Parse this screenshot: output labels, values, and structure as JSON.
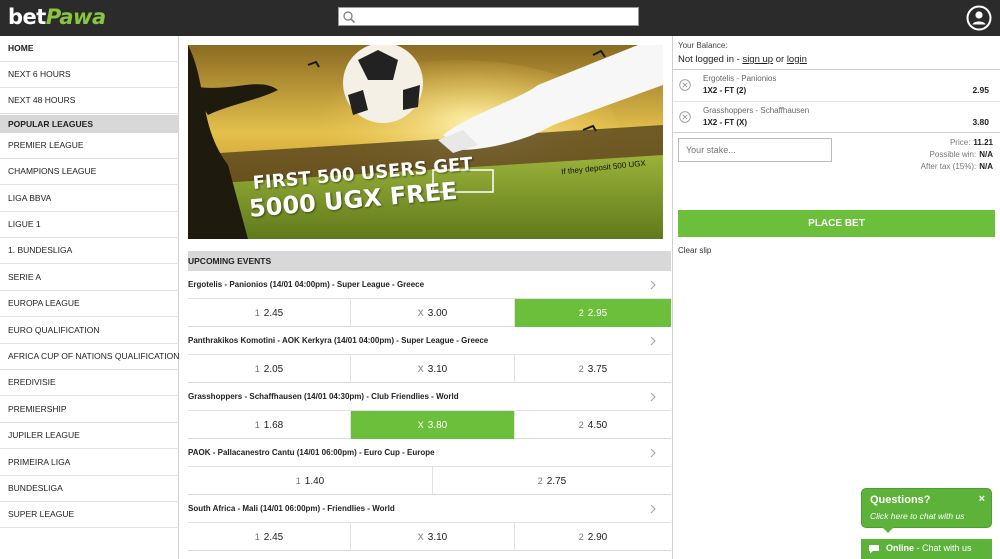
{
  "header": {
    "logo_part1": "bet",
    "logo_part2": "Pawa",
    "search_placeholder": "",
    "search_icon": "search-icon",
    "user_icon": "user-circle-icon"
  },
  "sidebar": {
    "items_top": [
      "HOME",
      "NEXT 6 HOURS",
      "NEXT 48 HOURS"
    ],
    "popular_heading": "POPULAR LEAGUES",
    "leagues": [
      "PREMIER LEAGUE",
      "CHAMPIONS LEAGUE",
      "LIGA BBVA",
      "LIGUE 1",
      "1. BUNDESLIGA",
      "SERIE A",
      "EUROPA LEAGUE",
      "EURO QUALIFICATION",
      "AFRICA CUP OF NATIONS QUALIFICATION",
      "EREDIVISIE",
      "PREMIERSHIP",
      "JUPILER LEAGUE",
      "PRIMEIRA LIGA",
      "BUNDESLIGA",
      "SUPER LEAGUE"
    ]
  },
  "banner": {
    "line1": "FIRST 500 USERS GET",
    "line2": "5000 UGX FREE",
    "note": "If they deposit 500 UGX"
  },
  "events": {
    "heading": "UPCOMING EVENTS",
    "list": [
      {
        "title": "Ergotelis - Panionios (14/01 04:00pm) - Super League - Greece",
        "odds": [
          {
            "key": "1",
            "value": "2.45",
            "selected": false
          },
          {
            "key": "X",
            "value": "3.00",
            "selected": false
          },
          {
            "key": "2",
            "value": "2.95",
            "selected": true
          }
        ]
      },
      {
        "title": "Panthrakikos Komotini - AOK Kerkyra (14/01 04:00pm) - Super League - Greece",
        "odds": [
          {
            "key": "1",
            "value": "2.05",
            "selected": false
          },
          {
            "key": "X",
            "value": "3.10",
            "selected": false
          },
          {
            "key": "2",
            "value": "3.75",
            "selected": false
          }
        ]
      },
      {
        "title": "Grasshoppers - Schaffhausen (14/01 04:30pm) - Club Friendlies - World",
        "odds": [
          {
            "key": "1",
            "value": "1.68",
            "selected": false
          },
          {
            "key": "X",
            "value": "3.80",
            "selected": true
          },
          {
            "key": "2",
            "value": "4.50",
            "selected": false
          }
        ]
      },
      {
        "title": "PAOK - Pallacanestro Cantu (14/01 06:00pm) - Euro Cup - Europe",
        "odds": [
          {
            "key": "1",
            "value": "1.40",
            "selected": false
          },
          {
            "key": "2",
            "value": "2.75",
            "selected": false
          }
        ]
      },
      {
        "title": "South Africa - Mali (14/01 06:00pm) - Friendlies - World",
        "odds": [
          {
            "key": "1",
            "value": "2.45",
            "selected": false
          },
          {
            "key": "X",
            "value": "3.10",
            "selected": false
          },
          {
            "key": "2",
            "value": "2.90",
            "selected": false
          }
        ]
      }
    ]
  },
  "betslip": {
    "balance_label": "Your Balance:",
    "not_logged": "Not logged in - ",
    "sign_up": "sign up",
    "or": " or ",
    "login": "login",
    "selections": [
      {
        "match": "Ergotelis - Panionios",
        "pick": "1X2 - FT (2)",
        "odd": "2.95"
      },
      {
        "match": "Grasshoppers - Schaffhausen",
        "pick": "1X2 - FT (X)",
        "odd": "3.80"
      }
    ],
    "stake_placeholder": "Your stake...",
    "price_label": "Price:",
    "price_value": "11.21",
    "possible_win_label": "Possible win:",
    "possible_win_value": "N/A",
    "after_tax_label": "After tax (15%):",
    "after_tax_value": "N/A",
    "place_bet": "PLACE BET",
    "clear_slip": "Clear slip"
  },
  "chat": {
    "question": "Questions?",
    "sub": "Click here to chat with us",
    "close": "×",
    "status": "Online",
    "status_text": " - Chat with us"
  },
  "colors": {
    "topbar": "#2b2b2b",
    "brand_green": "#8bc53f",
    "selected_odd": "#6cbf3a",
    "section_gray": "#d8d8d8"
  }
}
